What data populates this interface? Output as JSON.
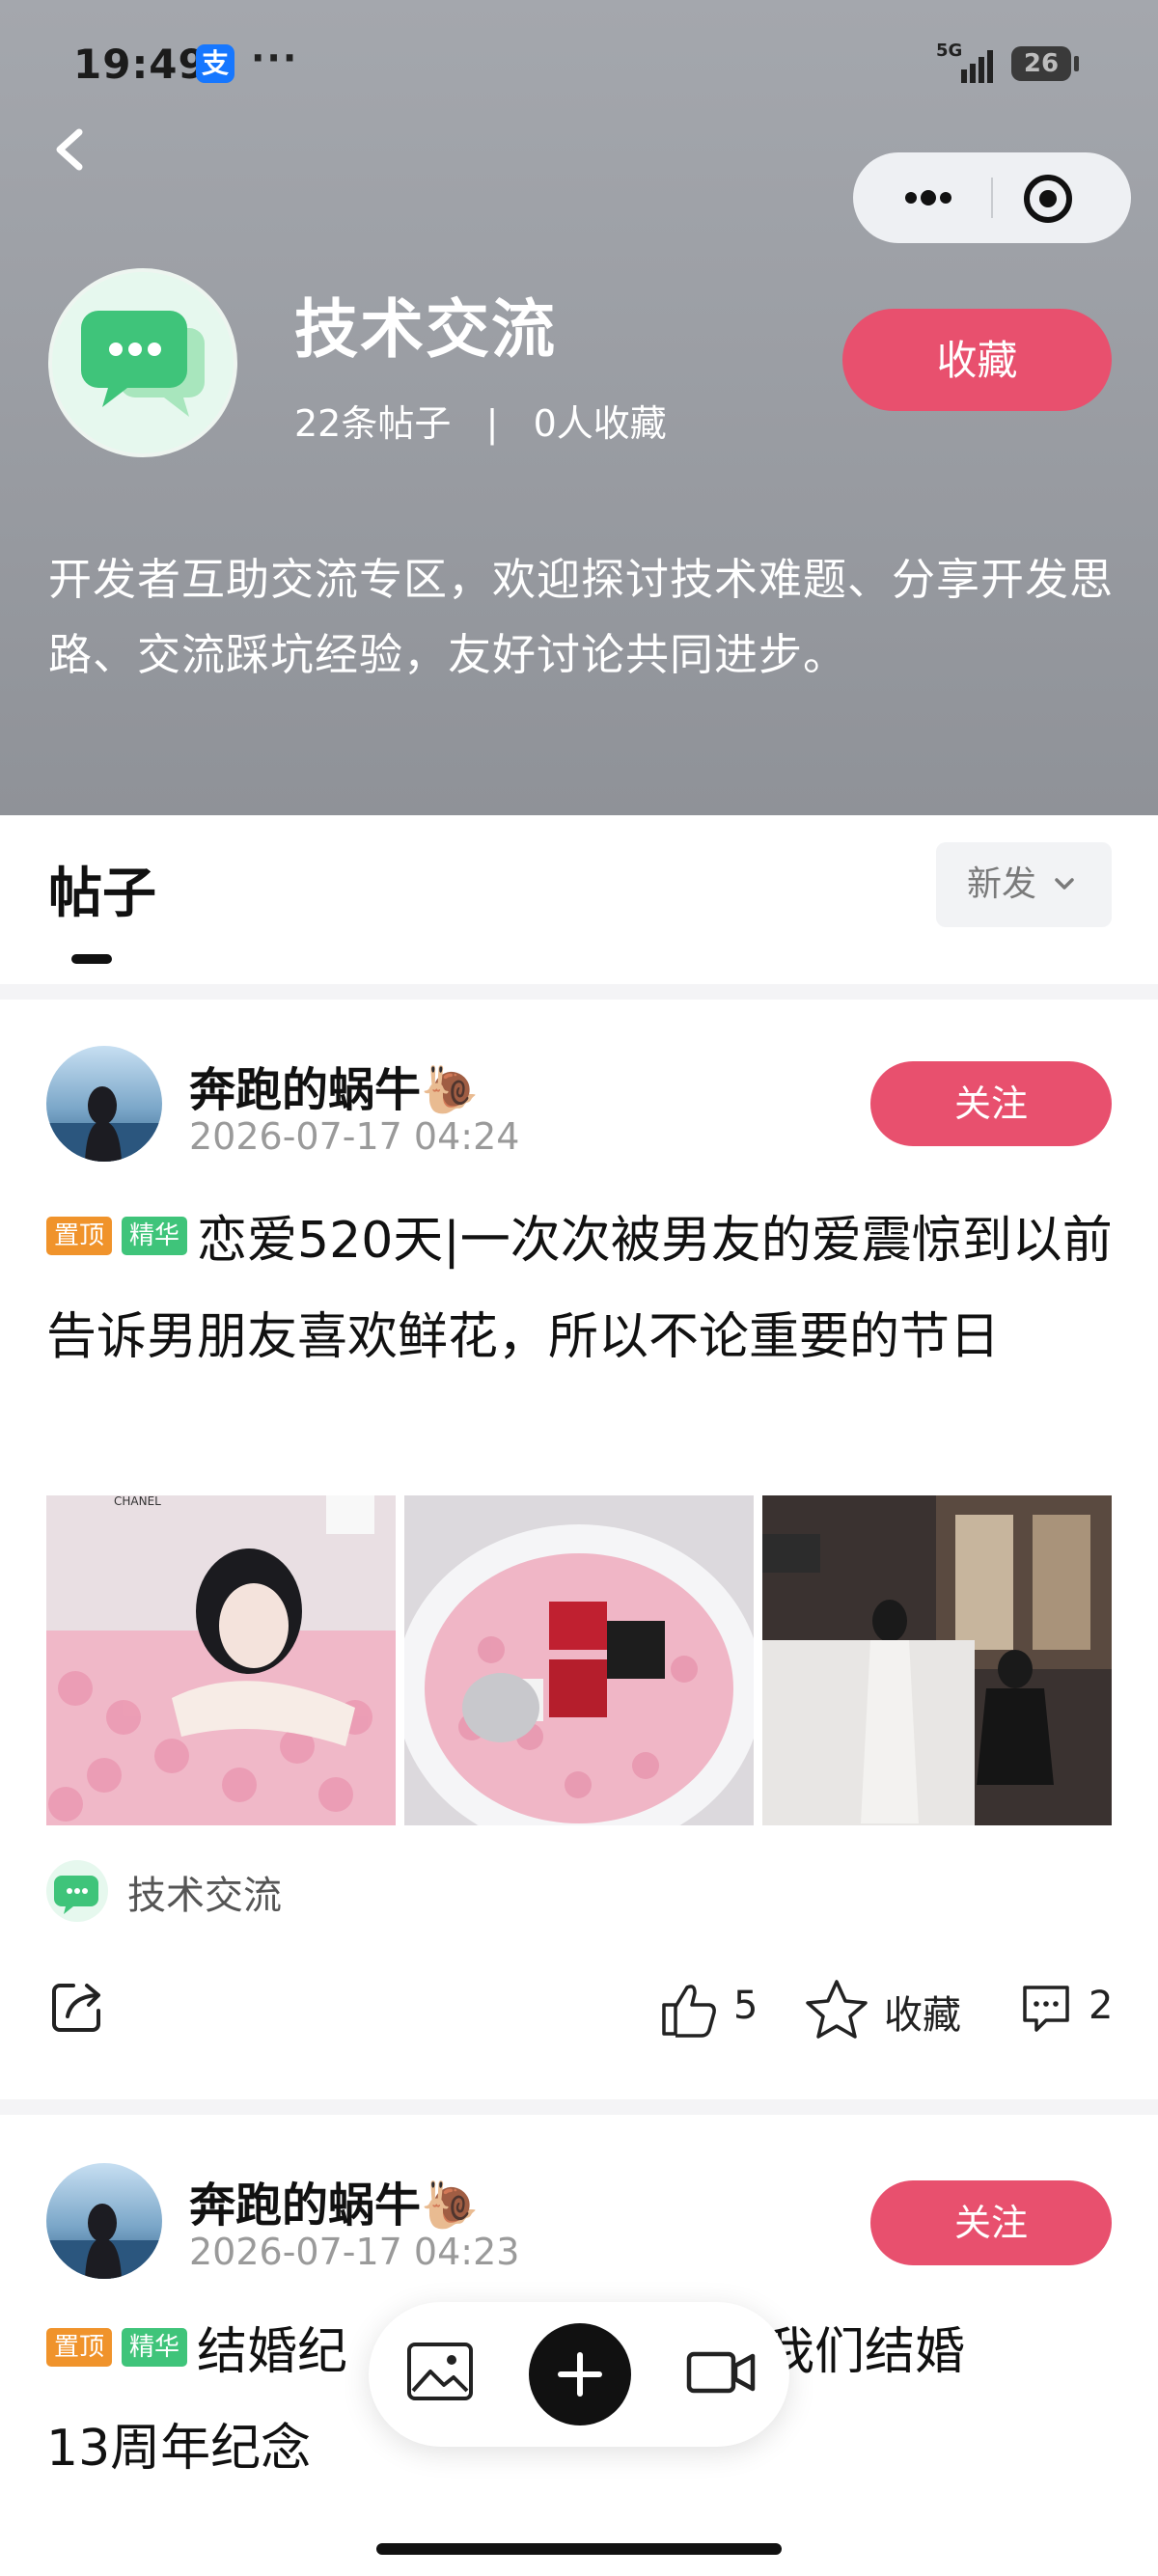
{
  "status_bar": {
    "time": "19:49",
    "app_badge": "支",
    "dots": "···",
    "network": "5G",
    "battery": "26"
  },
  "forum": {
    "title": "技术交流",
    "stats": "22条帖子   |   0人收藏",
    "favorite_label": "收藏",
    "description": "开发者互助交流专区，欢迎探讨技术难题、分享开发思路、交流踩坑经验，友好讨论共同进步。"
  },
  "tabs": {
    "active": "帖子",
    "sort": "新发"
  },
  "posts": [
    {
      "author": "奔跑的蜗牛🐌",
      "time": "2026-07-17 04:24",
      "follow_label": "关注",
      "badge_top": "置顶",
      "badge_elite": "精华",
      "text": "恋爱520天|一次次被男友的爱震惊到以前告诉男朋友喜欢鲜花，所以不论重要的节日",
      "tag": "技术交流",
      "likes": "5",
      "collect_label": "收藏",
      "comments": "2"
    },
    {
      "author": "奔跑的蜗牛🐌",
      "time": "2026-07-17 04:23",
      "follow_label": "关注",
      "badge_top": "置顶",
      "badge_elite": "精华",
      "text_visible_left": "结婚纪",
      "text_visible_right": "是我们结婚",
      "text_line2": "13周年纪念"
    }
  ],
  "colors": {
    "accent": "#e8506e",
    "header_bg": "#9c9fa5",
    "badge_top": "#f0932b",
    "badge_elite": "#3fc47a"
  },
  "icons": [
    "back-icon",
    "more-icon",
    "target-icon",
    "chat-bubble-icon",
    "chevron-down-icon",
    "share-icon",
    "thumb-up-icon",
    "star-icon",
    "comment-icon",
    "image-icon",
    "plus-icon",
    "video-icon"
  ]
}
